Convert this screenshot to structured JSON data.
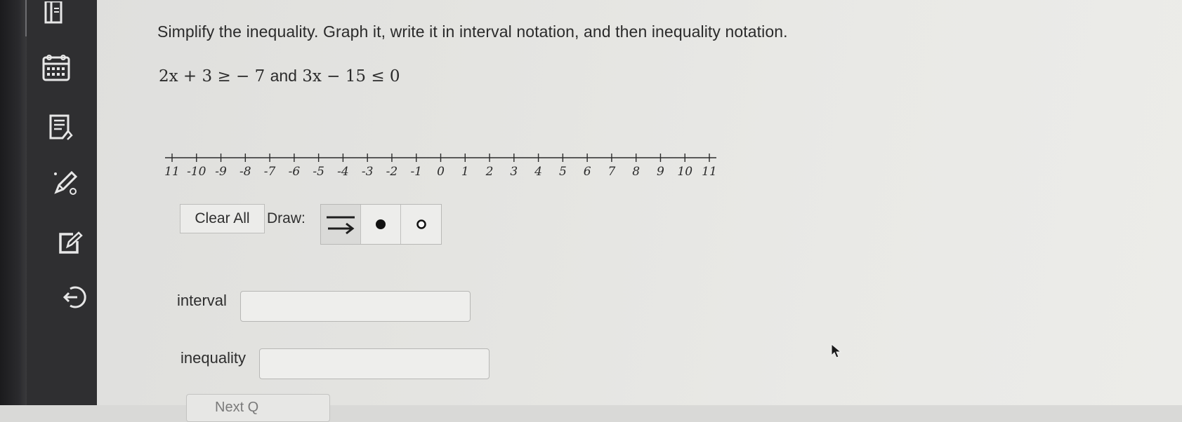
{
  "sidebar": {
    "items": [
      {
        "icon": "table-icon"
      },
      {
        "icon": "calendar-icon"
      },
      {
        "icon": "notes-icon"
      },
      {
        "icon": "pencil-icon"
      },
      {
        "icon": "edit-box-icon"
      },
      {
        "icon": "logout-icon"
      }
    ]
  },
  "question": {
    "prompt": "Simplify the inequality. Graph it, write it in interval notation, and then inequality notation.",
    "equation": {
      "part1": "2x + 3 ≥ − 7",
      "joiner": "and",
      "part2": "3x − 15 ≤ 0"
    }
  },
  "number_line": {
    "min": -11,
    "max": 11,
    "tick_labels": [
      "11",
      "-10",
      "-9",
      "-8",
      "-7",
      "-6",
      "-5",
      "-4",
      "-3",
      "-2",
      "-1",
      "0",
      "1",
      "2",
      "3",
      "4",
      "5",
      "6",
      "7",
      "8",
      "9",
      "10",
      "11"
    ]
  },
  "tools": {
    "clear_all_label": "Clear All",
    "draw_label": "Draw:",
    "draw_options": [
      {
        "icon": "ray-arrow-icon"
      },
      {
        "icon": "closed-dot-icon"
      },
      {
        "icon": "open-dot-icon"
      }
    ]
  },
  "answers": {
    "interval_label": "interval",
    "interval_value": "",
    "inequality_label": "inequality",
    "inequality_value": ""
  },
  "footer": {
    "next_label": "Next Q"
  },
  "colors": {
    "page_background": "#e6e6e3",
    "sidebar": "#2f2f31",
    "text": "#2b2b2b"
  }
}
